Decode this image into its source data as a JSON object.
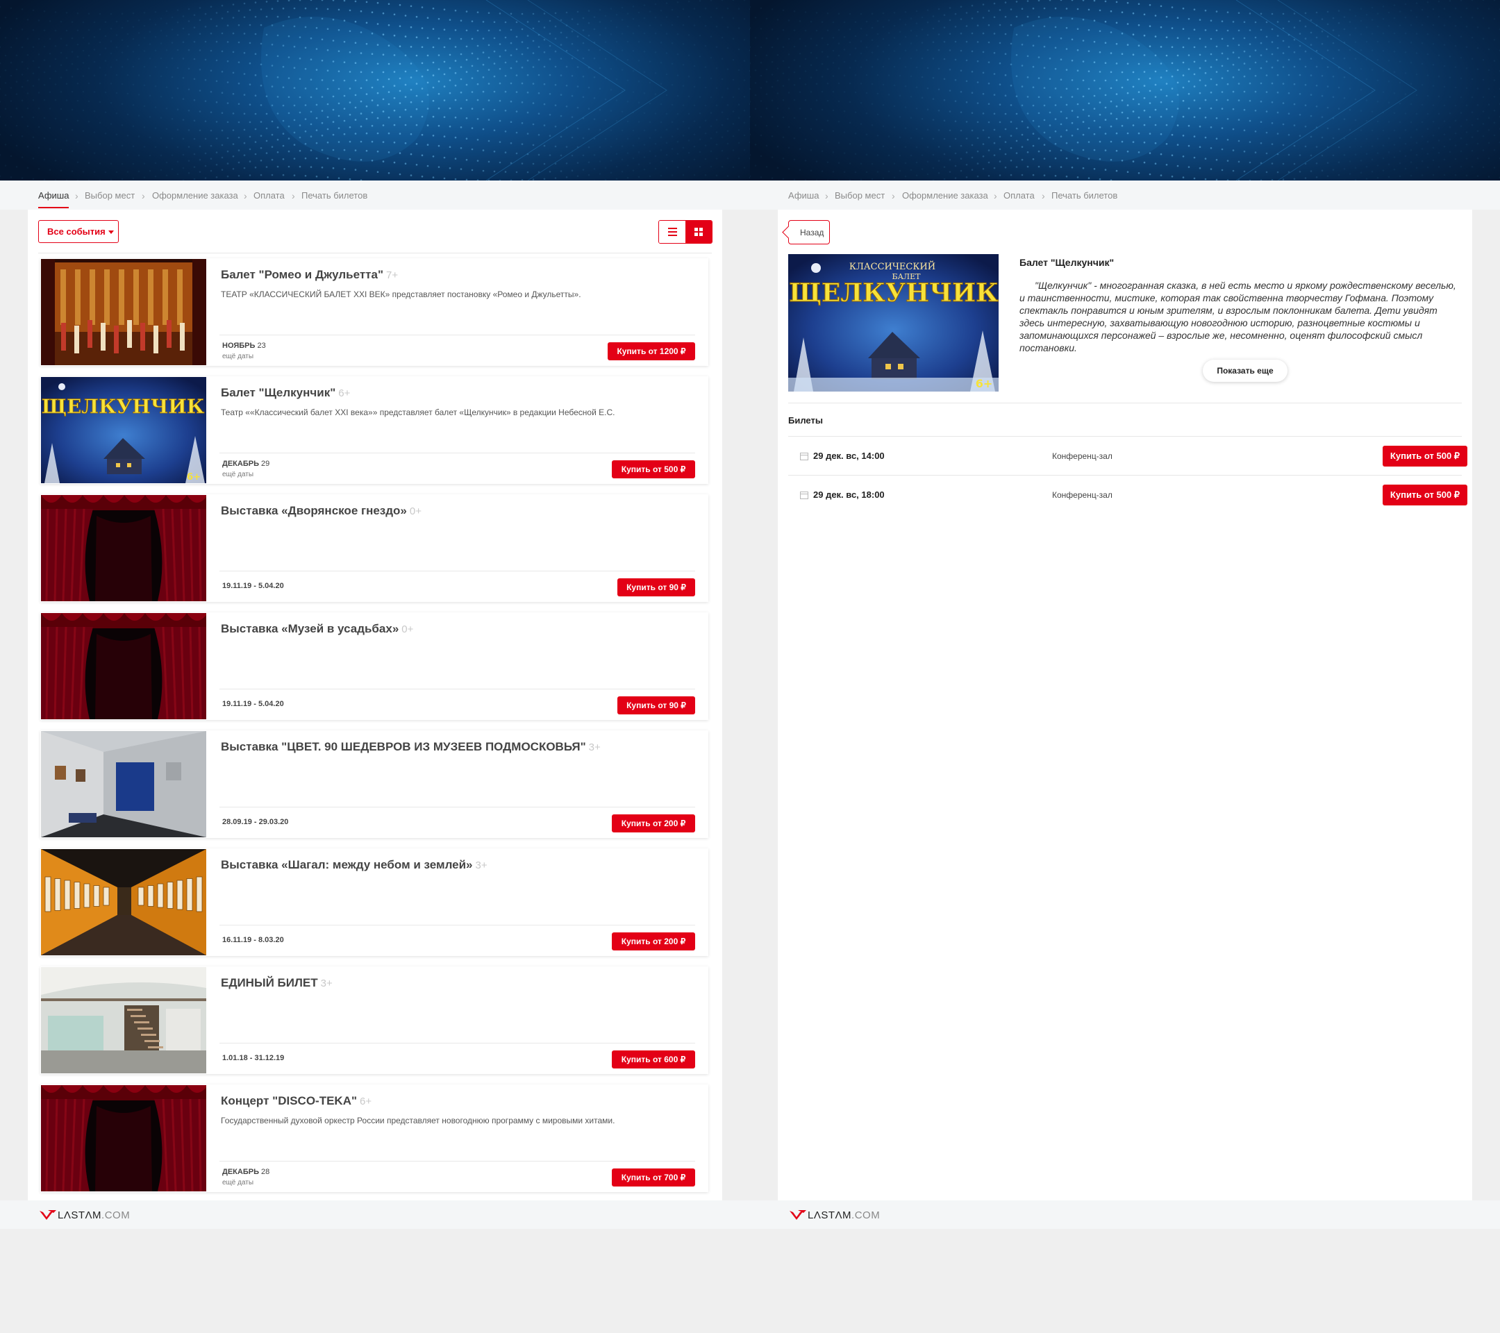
{
  "colors": {
    "accent": "#e30016",
    "banner_dark": "#04162e",
    "banner_light": "#1f7fbf"
  },
  "steps": [
    "Афиша",
    "Выбор мест",
    "Оформление заказа",
    "Оплата",
    "Печать билетов"
  ],
  "footer": {
    "logo_main": "LΛSTΛM",
    "logo_suffix": ".COM"
  },
  "list_page": {
    "filter_label": "Все события",
    "view_toggle": {
      "list_icon": "list-icon",
      "grid_icon": "grid-icon",
      "active": "grid"
    },
    "events": [
      {
        "title": "Балет \"Ромео и Джульетта\"",
        "age": "7+",
        "desc": "ТЕАТР «КЛАССИЧЕСКИЙ БАЛЕТ XXI ВЕК» представляет постановку «Ромео и Джульетты».",
        "month": "НОЯБРЬ",
        "day": "23",
        "more": "ещё даты",
        "date_range": "",
        "buy": "Купить от 1200 ₽",
        "image": "stage-performance"
      },
      {
        "title": "Балет \"Щелкунчик\"",
        "age": "6+",
        "desc": "Театр ««Классический балет XXI века»» представляет балет «Щелкунчик» в редакции Небесной Е.С.",
        "month": "ДЕКАБРЬ",
        "day": "29",
        "more": "ещё даты",
        "date_range": "",
        "buy": "Купить от 500 ₽",
        "image": "nutcracker-poster"
      },
      {
        "title": "Выставка «Дворянское гнездо»",
        "age": "0+",
        "desc": "",
        "month": "",
        "day": "",
        "more": "",
        "date_range": "19.11.19 - 5.04.20",
        "buy": "Купить от 90 ₽",
        "image": "red-curtain"
      },
      {
        "title": "Выставка «Музей в усадьбах»",
        "age": "0+",
        "desc": "",
        "month": "",
        "day": "",
        "more": "",
        "date_range": "19.11.19 - 5.04.20",
        "buy": "Купить от 90 ₽",
        "image": "red-curtain"
      },
      {
        "title": "Выставка \"ЦВЕТ. 90 ШЕДЕВРОВ ИЗ МУЗЕЕВ ПОДМОСКОВЬЯ\"",
        "age": "3+",
        "desc": "",
        "month": "",
        "day": "",
        "more": "",
        "date_range": "28.09.19 - 29.03.20",
        "buy": "Купить от 200 ₽",
        "image": "gallery-hall"
      },
      {
        "title": "Выставка «Шагал: между небом и землей»",
        "age": "3+",
        "desc": "",
        "month": "",
        "day": "",
        "more": "",
        "date_range": "16.11.19 - 8.03.20",
        "buy": "Купить от 200 ₽",
        "image": "orange-gallery"
      },
      {
        "title": "ЕДИНЫЙ БИЛЕТ",
        "age": "3+",
        "desc": "",
        "month": "",
        "day": "",
        "more": "",
        "date_range": "1.01.18 - 31.12.19",
        "buy": "Купить от 600 ₽",
        "image": "museum-interior"
      },
      {
        "title": "Концерт \"DISCO-TEKA\"",
        "age": "6+",
        "desc": "Государственный духовой оркестр России представляет новогоднюю программу с мировыми хитами.",
        "month": "ДЕКАБРЬ",
        "day": "28",
        "more": "ещё даты",
        "date_range": "",
        "buy": "Купить от 700 ₽",
        "image": "red-curtain"
      }
    ]
  },
  "detail_page": {
    "back_label": "Назад",
    "title": "Балет \"Щелкунчик\"",
    "description": "\"Щелкунчик\" - многогранная сказка, в ней есть место и яркому рождественскому веселью, и таинственности, мистике, которая так свойственна творчеству Гофмана. Поэтому спектакль понравится и юным зрителям, и взрослым поклонникам балета. Дети увидят здесь интересную, захватывающую новогоднюю историю, разноцветные костюмы и запоминающихся персонажей – взрослые же, несомненно, оценят философский смысл постановки.",
    "show_more": "Показать еще",
    "poster": {
      "title": "ЩЕЛКУНЧИК",
      "line1": "КЛАССИЧЕСКИЙ",
      "line2": "БАЛЕТ",
      "age": "6+"
    },
    "tickets_heading": "Билеты",
    "tickets": [
      {
        "date": "29 дек. вс, 14:00",
        "hall": "Конференц-зал",
        "buy": "Купить от 500 ₽"
      },
      {
        "date": "29 дек. вс, 18:00",
        "hall": "Конференц-зал",
        "buy": "Купить от 500 ₽"
      }
    ]
  }
}
